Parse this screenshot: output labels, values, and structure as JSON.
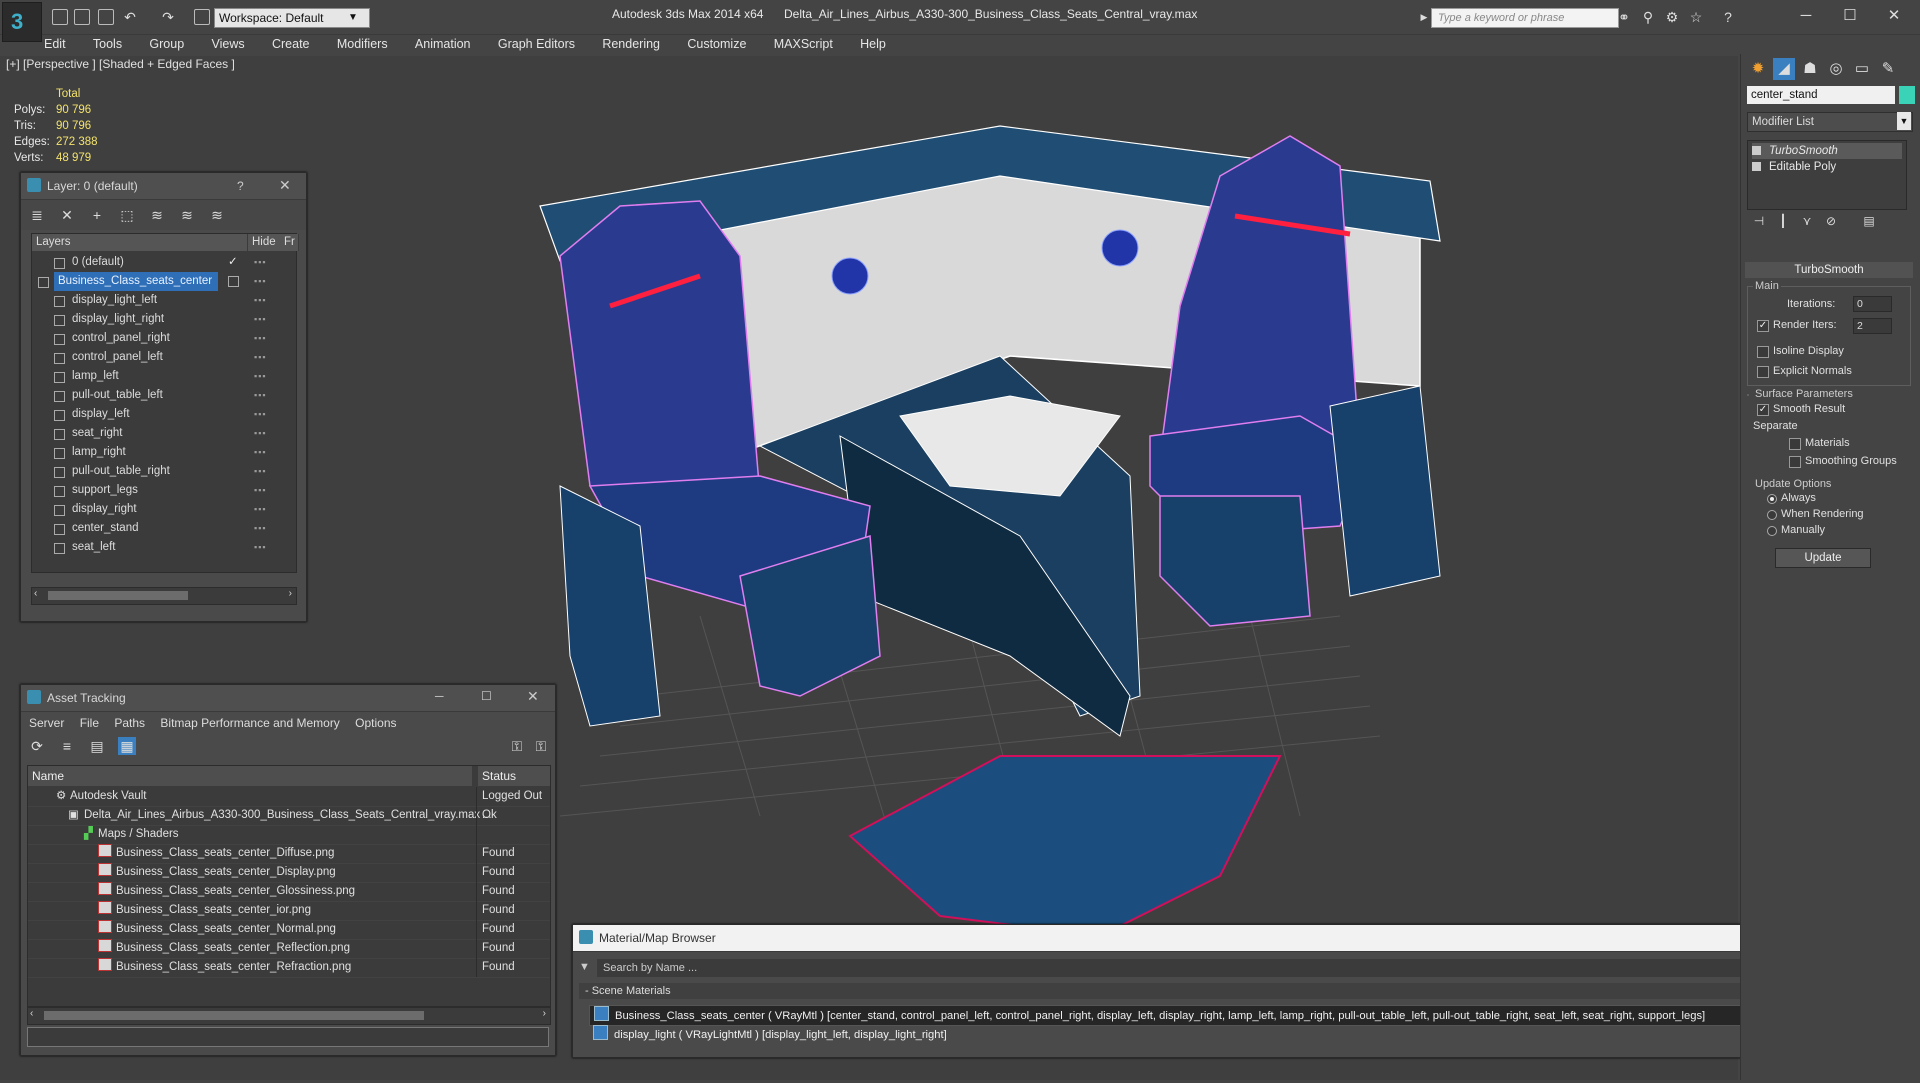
{
  "titlebar": {
    "workspace": "Workspace: Default",
    "app_name": "Autodesk 3ds Max  2014 x64",
    "file_name": "Delta_Air_Lines_Airbus_A330-300_Business_Class_Seats_Central_vray.max",
    "search_placeholder": "Type a keyword or phrase"
  },
  "menu": [
    "Edit",
    "Tools",
    "Group",
    "Views",
    "Create",
    "Modifiers",
    "Animation",
    "Graph Editors",
    "Rendering",
    "Customize",
    "MAXScript",
    "Help"
  ],
  "viewport": {
    "label": "[+] [Perspective ] [Shaded + Edged Faces ]",
    "stats": {
      "header": "Total",
      "rows": [
        {
          "label": "Polys:",
          "value": "90 796"
        },
        {
          "label": "Tris:",
          "value": "90 796"
        },
        {
          "label": "Edges:",
          "value": "272 388"
        },
        {
          "label": "Verts:",
          "value": "48 979"
        }
      ]
    }
  },
  "layer_window": {
    "title": "Layer: 0 (default)",
    "help": "?",
    "columns": {
      "layers": "Layers",
      "hide": "Hide",
      "freeze": "Fr"
    },
    "rows": [
      {
        "name": "0 (default)",
        "check": "✓"
      },
      {
        "name": "Business_Class_seats_center"
      },
      {
        "name": "display_light_left"
      },
      {
        "name": "display_light_right"
      },
      {
        "name": "control_panel_right"
      },
      {
        "name": "control_panel_left"
      },
      {
        "name": "lamp_left"
      },
      {
        "name": "pull-out_table_left"
      },
      {
        "name": "display_left"
      },
      {
        "name": "seat_right"
      },
      {
        "name": "lamp_right"
      },
      {
        "name": "pull-out_table_right"
      },
      {
        "name": "support_legs"
      },
      {
        "name": "display_right"
      },
      {
        "name": "center_stand"
      },
      {
        "name": "seat_left"
      }
    ]
  },
  "asset_window": {
    "title": "Asset Tracking",
    "menu": [
      "Server",
      "File",
      "Paths",
      "Bitmap Performance and Memory",
      "Options"
    ],
    "columns": {
      "name": "Name",
      "status": "Status"
    },
    "rows": [
      {
        "name": "Autodesk Vault",
        "status": "Logged Out ..."
      },
      {
        "name": "Delta_Air_Lines_Airbus_A330-300_Business_Class_Seats_Central_vray.max",
        "status": "Ok"
      },
      {
        "name": "Maps / Shaders",
        "status": ""
      },
      {
        "name": "Business_Class_seats_center_Diffuse.png",
        "status": "Found"
      },
      {
        "name": "Business_Class_seats_center_Display.png",
        "status": "Found"
      },
      {
        "name": "Business_Class_seats_center_Glossiness.png",
        "status": "Found"
      },
      {
        "name": "Business_Class_seats_center_ior.png",
        "status": "Found"
      },
      {
        "name": "Business_Class_seats_center_Normal.png",
        "status": "Found"
      },
      {
        "name": "Business_Class_seats_center_Reflection.png",
        "status": "Found"
      },
      {
        "name": "Business_Class_seats_center_Refraction.png",
        "status": "Found"
      }
    ]
  },
  "material_browser": {
    "title": "Material/Map Browser",
    "search_placeholder": "Search by Name ...",
    "section": "- Scene Materials",
    "materials": [
      "Business_Class_seats_center ( VRayMtl ) [center_stand, control_panel_left, control_panel_right, display_left, display_right, lamp_left, lamp_right, pull-out_table_left, pull-out_table_right, seat_left, seat_right, support_legs]",
      "display_light ( VRayLightMtl ) [display_light_left, display_light_right]"
    ]
  },
  "command_panel": {
    "object_name": "center_stand",
    "object_color": "#3ad3b8",
    "modifier_list": "Modifier List",
    "stack": [
      "TurboSmooth",
      "Editable Poly"
    ],
    "turbosmooth": {
      "title": "TurboSmooth",
      "main_label": "Main",
      "iterations_label": "Iterations:",
      "iterations": "0",
      "render_iters_label": "Render Iters:",
      "render_iters": "2",
      "render_iters_checked": "✓",
      "isoline": "Isoline Display",
      "explicit_normals": "Explicit Normals",
      "surface_params": "Surface Parameters",
      "smooth_result": "Smooth Result",
      "smooth_result_checked": "✓",
      "separate": "Separate",
      "materials": "Materials",
      "smoothing_groups": "Smoothing Groups",
      "update_options": "Update Options",
      "always": "Always",
      "when_rendering": "When Rendering",
      "manually": "Manually",
      "update_button": "Update"
    }
  }
}
